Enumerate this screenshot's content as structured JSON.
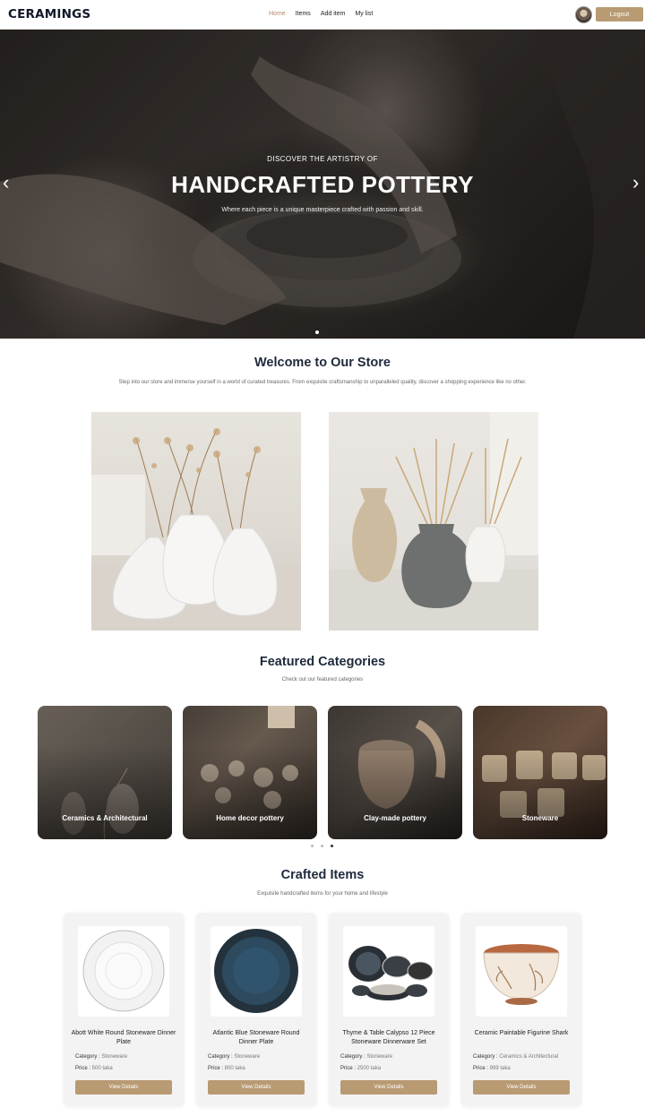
{
  "nav": {
    "brand": "CERAMINGS",
    "links": [
      "Home",
      "Items",
      "Add item",
      "My list"
    ],
    "active_link": "Home",
    "logout_label": "Logout",
    "accent_color": "#b89a73"
  },
  "hero": {
    "subtitle": "DISCOVER THE ARTISTRY OF",
    "title": "HANDCRAFTED POTTERY",
    "description": "Where each piece is a unique masterpiece crafted with passion and skill.",
    "prev_icon": "chevron-left-icon",
    "next_icon": "chevron-right-icon"
  },
  "welcome": {
    "title": "Welcome to Our Store",
    "description": "Step into our store and immerse yourself in a world of curated treasures. From exquisite craftsmanship to unparalleled quality, discover a shopping experience like no other."
  },
  "categories": {
    "title": "Featured Categories",
    "subtitle": "Check out our featured categories",
    "items": [
      {
        "label": "Ceramics & Architectural"
      },
      {
        "label": "Home decor pottery"
      },
      {
        "label": "Clay-made pottery"
      },
      {
        "label": "Stoneware"
      }
    ]
  },
  "items": {
    "title": "Crafted Items",
    "subtitle": "Exquisite handcrafted items for your home and lifestyle",
    "category_label": "Category : ",
    "price_label": "Price : ",
    "button_label": "View Details",
    "cards": [
      {
        "name": "Abott White Round Stoneware Dinner Plate",
        "category": "Stoneware",
        "price": "500 taka"
      },
      {
        "name": "Atlantic Blue Stoneware Round Dinner Plate",
        "category": "Stoneware",
        "price": "800 taka"
      },
      {
        "name": "Thyme & Table Calypso 12 Piece Stoneware Dinnerware Set",
        "category": "Stoneware",
        "price": "2500 taka"
      },
      {
        "name": "Ceramic Paintable Figurine Shark",
        "category": "Ceramics & Architectural",
        "price": "999 taka"
      }
    ]
  }
}
